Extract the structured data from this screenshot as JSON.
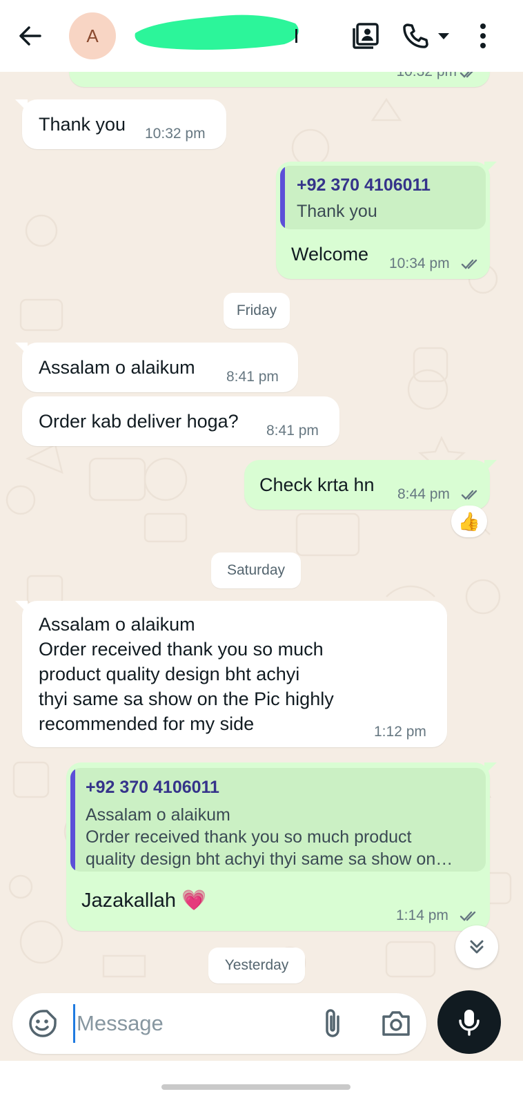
{
  "header": {
    "avatar_letter": "A",
    "back_icon": "arrow-left-icon",
    "contact_card_icon": "contact-card-icon",
    "call_icon": "phone-icon",
    "call_dropdown_icon": "caret-down-icon",
    "menu_icon": "more-vertical-icon"
  },
  "colors": {
    "incoming_bubble": "#ffffff",
    "outgoing_bubble": "#d9fdd3",
    "quote_bar": "#5c4fd8",
    "read_ticks": "#53bdeb",
    "chat_background": "#f5ede4",
    "redaction": "#2cf59a"
  },
  "messages": {
    "m0": {
      "time": "10:32 pm"
    },
    "m1": {
      "text": "Thank you",
      "time": "10:32 pm"
    },
    "m2": {
      "quote_author": "+92 370 4106011",
      "quote_text": "Thank you",
      "text": "Welcome",
      "time": "10:34 pm"
    },
    "m3": {
      "text": "Assalam o alaikum",
      "time": "8:41 pm"
    },
    "m4": {
      "text": "Order kab deliver hoga?",
      "time": "8:41 pm"
    },
    "m5": {
      "text": "Check krta hn",
      "time": "8:44 pm",
      "reaction": "👍"
    },
    "m6": {
      "text": "Assalam o alaikum\nOrder received thank you so much\nproduct quality design bht achyi\nthyi same sa show on the Pic highly\nrecommended for my side",
      "time": "1:12 pm"
    },
    "m7": {
      "quote_author": "+92 370 4106011",
      "quote_text": "Assalam o alaikum\nOrder received thank you so much product\nquality design bht achyi thyi same sa show on…",
      "text": "Jazakallah 💗",
      "time": "1:14 pm"
    }
  },
  "dates": {
    "friday": "Friday",
    "saturday": "Saturday",
    "yesterday": "Yesterday"
  },
  "composer": {
    "placeholder": "Message",
    "emoji_icon": "sticker-icon",
    "attach_icon": "paperclip-icon",
    "camera_icon": "camera-icon",
    "mic_icon": "microphone-icon"
  },
  "scroll_icon": "double-chevron-down-icon"
}
